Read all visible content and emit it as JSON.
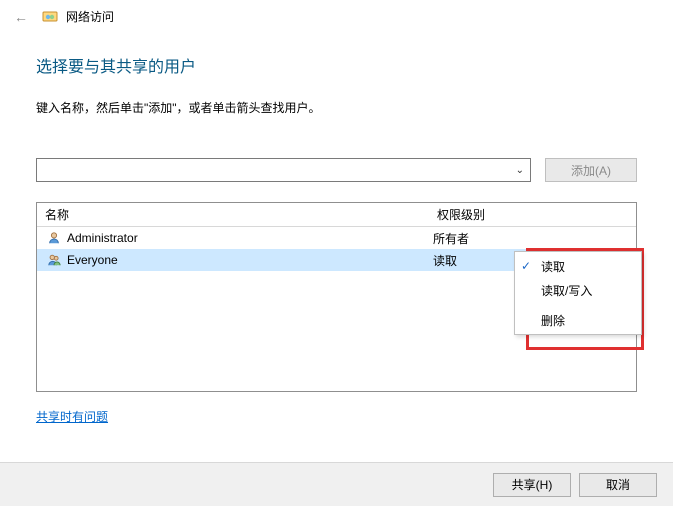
{
  "window": {
    "title": "网络访问"
  },
  "header": {
    "heading": "选择要与其共享的用户",
    "instruction": "键入名称，然后单击\"添加\"，或者单击箭头查找用户。"
  },
  "input": {
    "value": "",
    "add_label": "添加(A)"
  },
  "table": {
    "columns": {
      "name": "名称",
      "perm": "权限级别"
    },
    "rows": [
      {
        "name": "Administrator",
        "perm": "所有者",
        "icon": "user",
        "selected": false,
        "has_dropdown": false
      },
      {
        "name": "Everyone",
        "perm": "读取",
        "icon": "group",
        "selected": true,
        "has_dropdown": true
      }
    ]
  },
  "context_menu": {
    "items": [
      {
        "label": "读取",
        "checked": true
      },
      {
        "label": "读取/写入",
        "checked": false
      },
      {
        "label": "删除",
        "checked": false
      }
    ]
  },
  "help_link": "共享时有问题",
  "footer": {
    "share": "共享(H)",
    "cancel": "取消"
  }
}
